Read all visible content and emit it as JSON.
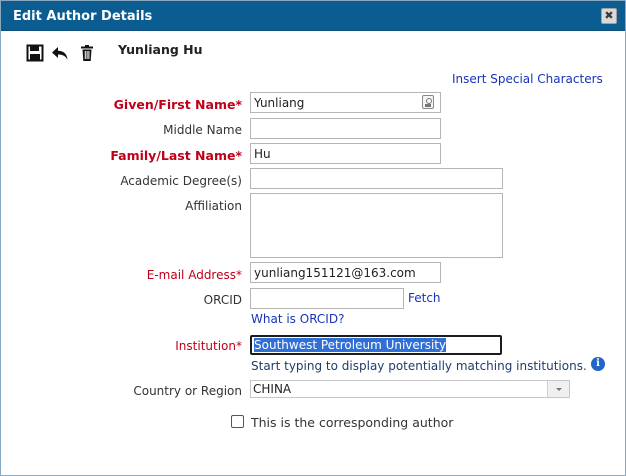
{
  "window": {
    "title": "Edit Author Details",
    "close_glyph": "✖"
  },
  "toolbar": {
    "icons": [
      "save-icon",
      "undo-icon",
      "delete-icon"
    ],
    "author_name": "Yunliang Hu",
    "special_chars_link": "Insert Special Characters"
  },
  "form": {
    "given_name": {
      "label": "Given/First Name*",
      "value": "Yunliang"
    },
    "middle_name": {
      "label": "Middle Name",
      "value": ""
    },
    "family_name": {
      "label": "Family/Last Name*",
      "value": "Hu"
    },
    "academic_degree": {
      "label": "Academic Degree(s)",
      "value": ""
    },
    "affiliation": {
      "label": "Affiliation",
      "value": ""
    },
    "email": {
      "label": "E-mail Address*",
      "value": "yunliang151121@163.com"
    },
    "orcid": {
      "label": "ORCID",
      "value": "",
      "fetch_link": "Fetch",
      "help_link": "What is ORCID?"
    },
    "institution": {
      "label": "Institution*",
      "value": "Southwest Petroleum University",
      "hint": "Start typing to display potentially matching institutions."
    },
    "country": {
      "label": "Country or Region",
      "value": "CHINA"
    },
    "corresponding": {
      "label": "This is the corresponding author",
      "checked": false
    }
  },
  "colors": {
    "titlebar": "#0b5d91",
    "required_label": "#c0001a",
    "link": "#1a33b8",
    "selection": "#2f6fd6"
  }
}
